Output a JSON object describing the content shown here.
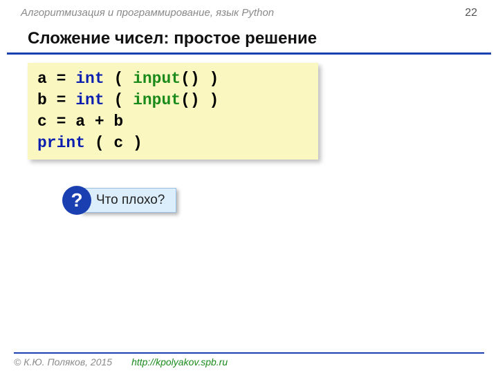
{
  "header": {
    "breadcrumb": "Алгоритмизация и программирование, язык Python",
    "page_number": "22"
  },
  "title": "Сложение чисел: простое решение",
  "code": {
    "line1": {
      "a": "a",
      "eq": " = ",
      "int": "int",
      "paren_open": " ( ",
      "input": "input",
      "call": "()",
      "paren_close": " )"
    },
    "line2": {
      "a": "b",
      "eq": " = ",
      "int": "int",
      "paren_open": " ( ",
      "input": "input",
      "call": "()",
      "paren_close": " )"
    },
    "line3": "c = a + b",
    "line4": {
      "print": "print",
      "args": " ( c )"
    }
  },
  "callout": {
    "mark": "?",
    "text": " Что плохо?"
  },
  "footer": {
    "copyright": "© К.Ю. Поляков, 2015",
    "url": "http://kpolyakov.spb.ru"
  }
}
